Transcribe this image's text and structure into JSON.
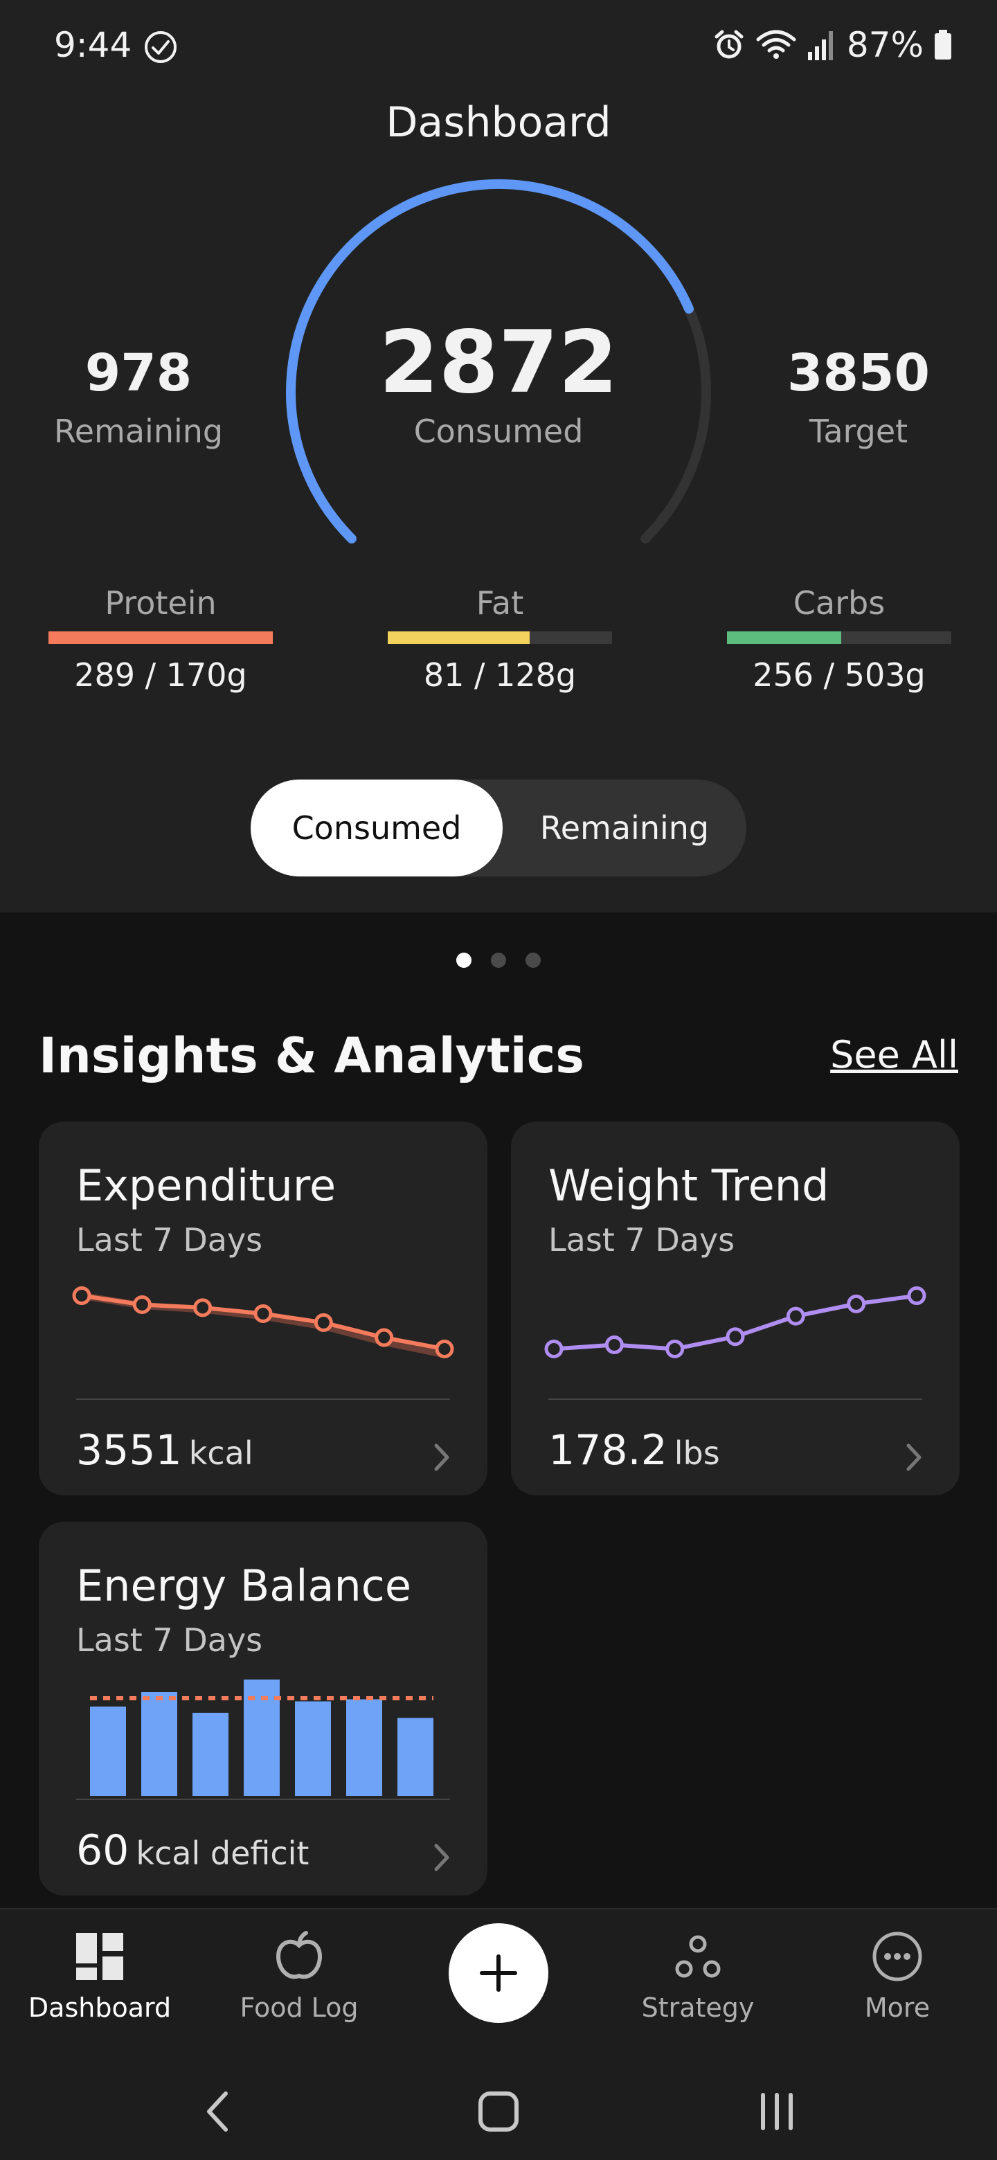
{
  "status_bar": {
    "time": "9:44",
    "battery": "87%"
  },
  "header": {
    "title": "Dashboard"
  },
  "calories": {
    "remaining": "978",
    "remaining_label": "Remaining",
    "consumed": "2872",
    "consumed_label": "Consumed",
    "target": "3850",
    "target_label": "Target",
    "progress": 0.746
  },
  "macros": [
    {
      "label": "Protein",
      "value": "289 / 170g",
      "progress": 1.0,
      "color": "#f47c5d"
    },
    {
      "label": "Fat",
      "value": "81 / 128g",
      "progress": 0.633,
      "color": "#f3d25e"
    },
    {
      "label": "Carbs",
      "value": "256 / 503g",
      "progress": 0.509,
      "color": "#5cbd7f"
    }
  ],
  "toggle": {
    "active": "Consumed",
    "inactive": "Remaining"
  },
  "pager": {
    "pages": 3,
    "active": 0
  },
  "insights": {
    "title": "Insights & Analytics",
    "see_all": "See All",
    "cards": [
      {
        "title": "Expenditure",
        "subtitle": "Last 7 Days",
        "value": "3551",
        "unit": "kcal",
        "color": "#f47c5d"
      },
      {
        "title": "Weight Trend",
        "subtitle": "Last 7 Days",
        "value": "178.2",
        "unit": "lbs",
        "color": "#b08df0"
      },
      {
        "title": "Energy Balance",
        "subtitle": "Last 7 Days",
        "value": "60",
        "unit": "kcal deficit",
        "color": "#6ea3f8",
        "target_color": "#f47c5d"
      }
    ]
  },
  "chart_data": [
    {
      "type": "line",
      "title": "Expenditure",
      "values": [
        3640,
        3625,
        3620,
        3610,
        3595,
        3570,
        3551
      ]
    },
    {
      "type": "line",
      "title": "Weight Trend",
      "values": [
        176.9,
        177.0,
        176.9,
        177.2,
        177.7,
        178.0,
        178.2
      ]
    },
    {
      "type": "bar",
      "title": "Energy Balance",
      "values": [
        86,
        100,
        80,
        112,
        91,
        93,
        75
      ],
      "target": 94,
      "ylim": [
        0,
        112
      ]
    }
  ],
  "nav": {
    "items": [
      {
        "label": "Dashboard",
        "icon": "dashboard-icon"
      },
      {
        "label": "Food Log",
        "icon": "apple-icon"
      },
      {
        "label": "Strategy",
        "icon": "strategy-icon"
      },
      {
        "label": "More",
        "icon": "more-icon"
      }
    ],
    "add_icon": "plus-icon"
  }
}
